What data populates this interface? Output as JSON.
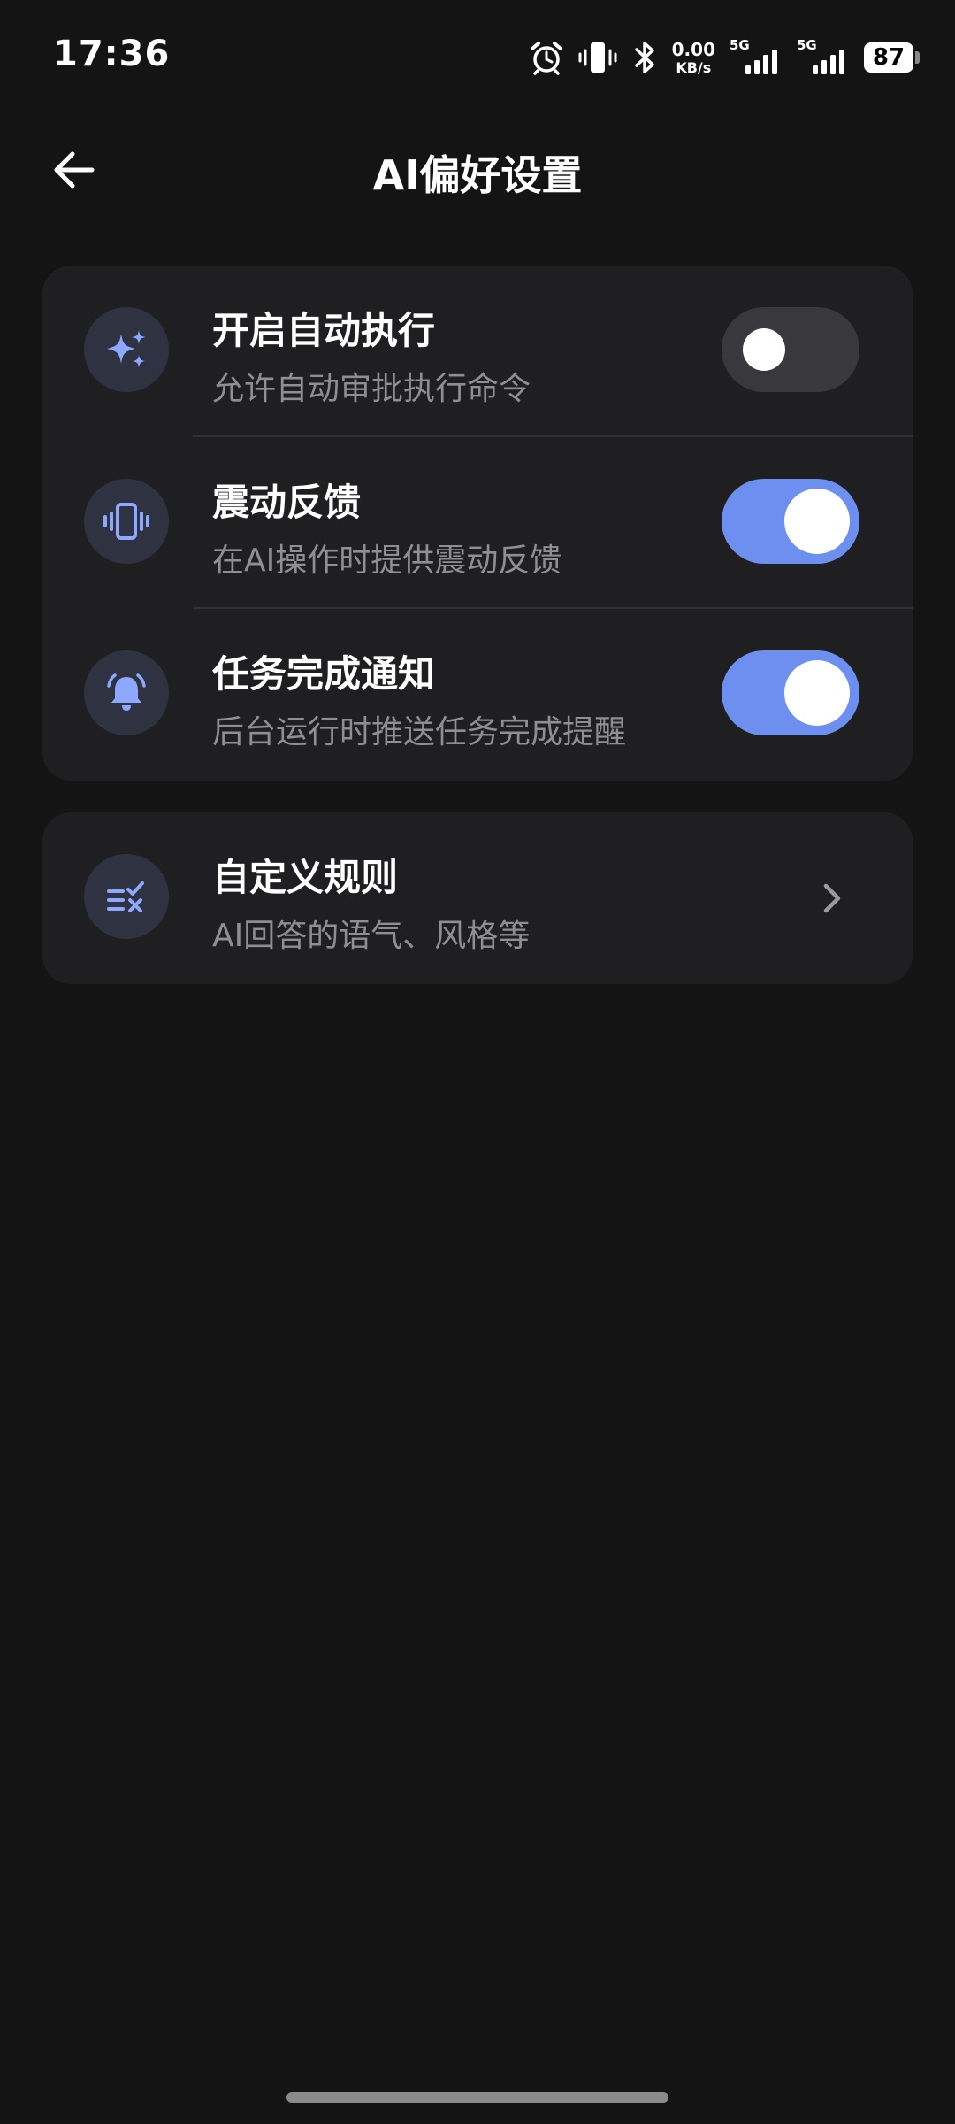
{
  "status_bar": {
    "time": "17:36",
    "net_speed_value": "0.00",
    "net_speed_unit": "KB/s",
    "sim1_tag": "5G",
    "sim2_tag": "5G",
    "battery_level": "87",
    "icons": [
      "alarm-icon",
      "vibrate-icon",
      "bluetooth-icon",
      "signal-icon",
      "signal-icon",
      "battery-icon"
    ]
  },
  "header": {
    "title": "AI偏好设置",
    "back_icon": "arrow-left-icon"
  },
  "settings": [
    {
      "icon": "sparkle-icon",
      "title": "开启自动执行",
      "subtitle": "允许自动审批执行命令",
      "enabled": false
    },
    {
      "icon": "vibrate-icon",
      "title": "震动反馈",
      "subtitle": "在AI操作时提供震动反馈",
      "enabled": true
    },
    {
      "icon": "bell-icon",
      "title": "任务完成通知",
      "subtitle": "后台运行时推送任务完成提醒",
      "enabled": true
    }
  ],
  "custom_rules": {
    "icon": "rules-icon",
    "title": "自定义规则",
    "subtitle": "AI回答的语气、风格等",
    "chevron_icon": "chevron-right-icon"
  },
  "colors": {
    "background": "#141415",
    "card": "#1f1f21",
    "accent": "#6d8ff0",
    "icon_tint": "#8fa8ff",
    "toggle_off": "#39393d",
    "subtitle": "#8e8e93"
  }
}
